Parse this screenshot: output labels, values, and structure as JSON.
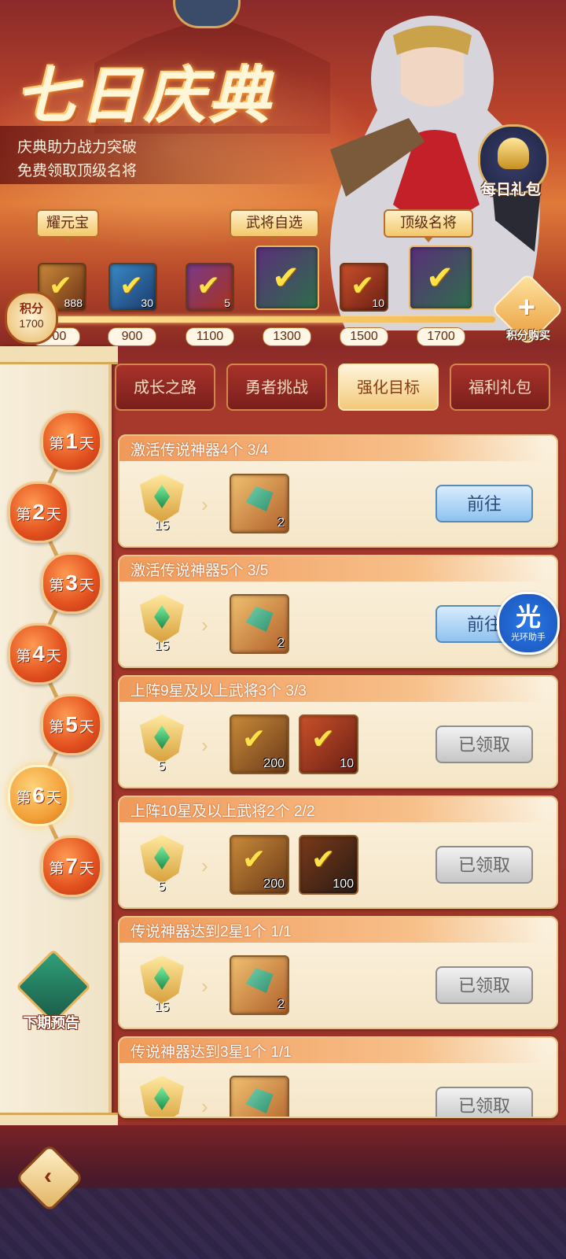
{
  "header": {
    "title": "七日庆典",
    "subtitle_line1": "庆典助力战力突破",
    "subtitle_line2": "免费领取顶级名将",
    "daily_gift_label": "每日礼包"
  },
  "reward_track": {
    "labels": [
      "耀元宝",
      "武将自选",
      "顶级名将"
    ],
    "points_label": "积分",
    "points_value": "1700",
    "items": [
      {
        "qty": "888"
      },
      {
        "qty": "30"
      },
      {
        "qty": "5"
      },
      {
        "qty": ""
      },
      {
        "qty": "10"
      },
      {
        "qty": ""
      }
    ],
    "milestones": [
      "700",
      "900",
      "1100",
      "1300",
      "1500",
      "1700"
    ],
    "buy_points_label": "积分购买"
  },
  "tabs": [
    {
      "label": "成长之路"
    },
    {
      "label": "勇者挑战"
    },
    {
      "label": "强化目标"
    },
    {
      "label": "福利礼包"
    }
  ],
  "days": [
    {
      "prefix": "第",
      "num": "1",
      "suffix": "天"
    },
    {
      "prefix": "第",
      "num": "2",
      "suffix": "天"
    },
    {
      "prefix": "第",
      "num": "3",
      "suffix": "天"
    },
    {
      "prefix": "第",
      "num": "4",
      "suffix": "天"
    },
    {
      "prefix": "第",
      "num": "5",
      "suffix": "天"
    },
    {
      "prefix": "第",
      "num": "6",
      "suffix": "天"
    },
    {
      "prefix": "第",
      "num": "7",
      "suffix": "天"
    }
  ],
  "active_day": "6",
  "next_preview_label": "下期预告",
  "tasks": [
    {
      "title": "激活传说神器4个 3/4",
      "emblem": "15",
      "items": [
        "2"
      ],
      "button": "前往"
    },
    {
      "title": "激活传说神器5个 3/5",
      "emblem": "15",
      "items": [
        "2"
      ],
      "button": "前往"
    },
    {
      "title": "上阵9星及以上武将3个 3/3",
      "emblem": "5",
      "items": [
        "200",
        "10"
      ],
      "button": "已领取"
    },
    {
      "title": "上阵10星及以上武将2个 2/2",
      "emblem": "5",
      "items": [
        "200",
        "100"
      ],
      "button": "已领取"
    },
    {
      "title": "传说神器达到2星1个 1/1",
      "emblem": "15",
      "items": [
        "2"
      ],
      "button": "已领取"
    },
    {
      "title": "传说神器达到3星1个 1/1",
      "emblem": "",
      "items": [
        ""
      ],
      "button": "已领取"
    }
  ],
  "helper": {
    "icon": "光",
    "label": "光环助手"
  },
  "colors": {
    "accent": "#e2501e",
    "active_tab": "#f2c97a",
    "go_button": "#8ec2ee",
    "done_button": "#c6c6c6"
  }
}
